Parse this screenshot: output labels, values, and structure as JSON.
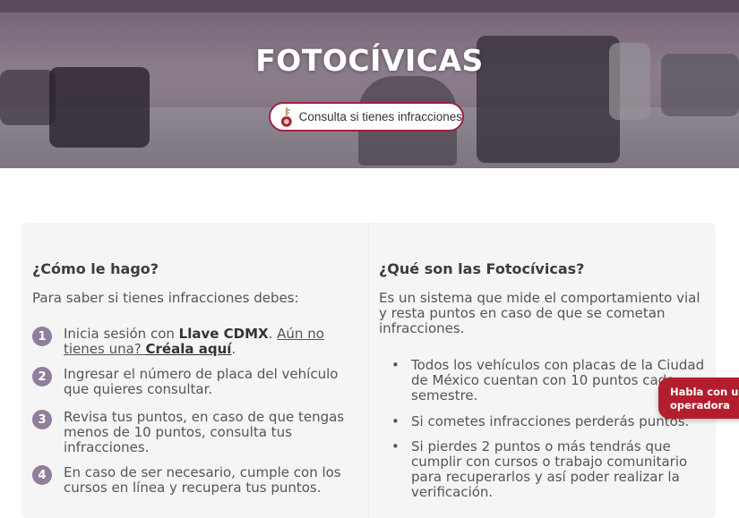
{
  "hero": {
    "title": "FOTOCÍVICAS",
    "consulta_button": "Consulta si tienes infracciones"
  },
  "left_column": {
    "heading": "¿Cómo le hago?",
    "intro": "Para saber si tienes infracciones debes:",
    "steps": [
      {
        "number": "1",
        "text_before": "Inicia sesión con ",
        "bold": "Llave CDMX",
        "text_after": ". ",
        "link_text": "Aún no tienes una? ",
        "link_bold": "Créala aquí",
        "end": "."
      },
      {
        "number": "2",
        "text": "Ingresar el número de placa del vehículo que quieres consultar."
      },
      {
        "number": "3",
        "text": "Revisa tus puntos, en caso de que tengas menos de 10 puntos, consulta tus infracciones."
      },
      {
        "number": "4",
        "text": "En caso de ser necesario, cumple con los cursos en línea y recupera tus puntos."
      }
    ]
  },
  "right_column": {
    "heading": "¿Qué son las Fotocívicas?",
    "intro": "Es un sistema que mide el comportamiento vial y resta puntos en caso de que se cometan infracciones.",
    "bullets": [
      "Todos los vehículos con placas de la Ciudad de México cuentan con 10 puntos cada semestre.",
      "Si cometes infracciones perderás puntos.",
      "Si pierdes 2 puntos o más tendrás que cumplir con cursos o trabajo comunitario para recuperarlos y así poder realizar la verificación."
    ]
  },
  "chat": {
    "line1": "Habla con una",
    "line2": "operadora"
  },
  "colors": {
    "brand": "#9b2247",
    "step_badge": "#8f7f9c",
    "chat": "#b21e2e"
  },
  "icons": {
    "consulta": "key-icon"
  }
}
